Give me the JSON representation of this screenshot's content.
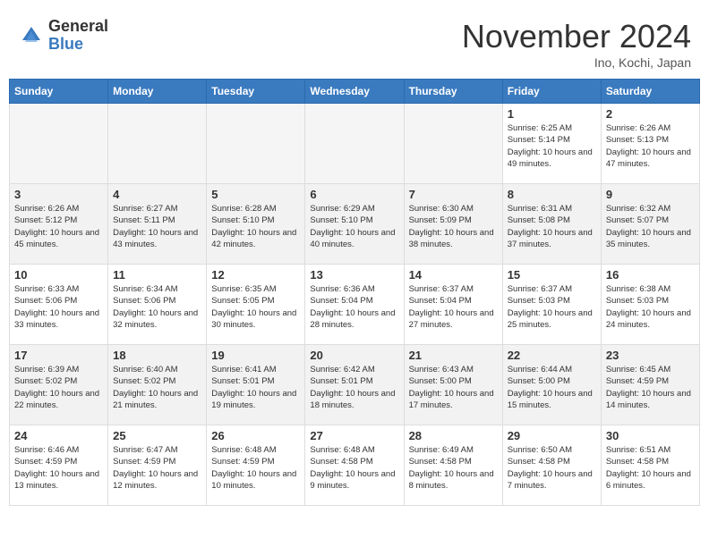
{
  "header": {
    "logo_general": "General",
    "logo_blue": "Blue",
    "month_title": "November 2024",
    "location": "Ino, Kochi, Japan"
  },
  "days_of_week": [
    "Sunday",
    "Monday",
    "Tuesday",
    "Wednesday",
    "Thursday",
    "Friday",
    "Saturday"
  ],
  "weeks": [
    [
      {
        "day": "",
        "info": ""
      },
      {
        "day": "",
        "info": ""
      },
      {
        "day": "",
        "info": ""
      },
      {
        "day": "",
        "info": ""
      },
      {
        "day": "",
        "info": ""
      },
      {
        "day": "1",
        "info": "Sunrise: 6:25 AM\nSunset: 5:14 PM\nDaylight: 10 hours and 49 minutes."
      },
      {
        "day": "2",
        "info": "Sunrise: 6:26 AM\nSunset: 5:13 PM\nDaylight: 10 hours and 47 minutes."
      }
    ],
    [
      {
        "day": "3",
        "info": "Sunrise: 6:26 AM\nSunset: 5:12 PM\nDaylight: 10 hours and 45 minutes."
      },
      {
        "day": "4",
        "info": "Sunrise: 6:27 AM\nSunset: 5:11 PM\nDaylight: 10 hours and 43 minutes."
      },
      {
        "day": "5",
        "info": "Sunrise: 6:28 AM\nSunset: 5:10 PM\nDaylight: 10 hours and 42 minutes."
      },
      {
        "day": "6",
        "info": "Sunrise: 6:29 AM\nSunset: 5:10 PM\nDaylight: 10 hours and 40 minutes."
      },
      {
        "day": "7",
        "info": "Sunrise: 6:30 AM\nSunset: 5:09 PM\nDaylight: 10 hours and 38 minutes."
      },
      {
        "day": "8",
        "info": "Sunrise: 6:31 AM\nSunset: 5:08 PM\nDaylight: 10 hours and 37 minutes."
      },
      {
        "day": "9",
        "info": "Sunrise: 6:32 AM\nSunset: 5:07 PM\nDaylight: 10 hours and 35 minutes."
      }
    ],
    [
      {
        "day": "10",
        "info": "Sunrise: 6:33 AM\nSunset: 5:06 PM\nDaylight: 10 hours and 33 minutes."
      },
      {
        "day": "11",
        "info": "Sunrise: 6:34 AM\nSunset: 5:06 PM\nDaylight: 10 hours and 32 minutes."
      },
      {
        "day": "12",
        "info": "Sunrise: 6:35 AM\nSunset: 5:05 PM\nDaylight: 10 hours and 30 minutes."
      },
      {
        "day": "13",
        "info": "Sunrise: 6:36 AM\nSunset: 5:04 PM\nDaylight: 10 hours and 28 minutes."
      },
      {
        "day": "14",
        "info": "Sunrise: 6:37 AM\nSunset: 5:04 PM\nDaylight: 10 hours and 27 minutes."
      },
      {
        "day": "15",
        "info": "Sunrise: 6:37 AM\nSunset: 5:03 PM\nDaylight: 10 hours and 25 minutes."
      },
      {
        "day": "16",
        "info": "Sunrise: 6:38 AM\nSunset: 5:03 PM\nDaylight: 10 hours and 24 minutes."
      }
    ],
    [
      {
        "day": "17",
        "info": "Sunrise: 6:39 AM\nSunset: 5:02 PM\nDaylight: 10 hours and 22 minutes."
      },
      {
        "day": "18",
        "info": "Sunrise: 6:40 AM\nSunset: 5:02 PM\nDaylight: 10 hours and 21 minutes."
      },
      {
        "day": "19",
        "info": "Sunrise: 6:41 AM\nSunset: 5:01 PM\nDaylight: 10 hours and 19 minutes."
      },
      {
        "day": "20",
        "info": "Sunrise: 6:42 AM\nSunset: 5:01 PM\nDaylight: 10 hours and 18 minutes."
      },
      {
        "day": "21",
        "info": "Sunrise: 6:43 AM\nSunset: 5:00 PM\nDaylight: 10 hours and 17 minutes."
      },
      {
        "day": "22",
        "info": "Sunrise: 6:44 AM\nSunset: 5:00 PM\nDaylight: 10 hours and 15 minutes."
      },
      {
        "day": "23",
        "info": "Sunrise: 6:45 AM\nSunset: 4:59 PM\nDaylight: 10 hours and 14 minutes."
      }
    ],
    [
      {
        "day": "24",
        "info": "Sunrise: 6:46 AM\nSunset: 4:59 PM\nDaylight: 10 hours and 13 minutes."
      },
      {
        "day": "25",
        "info": "Sunrise: 6:47 AM\nSunset: 4:59 PM\nDaylight: 10 hours and 12 minutes."
      },
      {
        "day": "26",
        "info": "Sunrise: 6:48 AM\nSunset: 4:59 PM\nDaylight: 10 hours and 10 minutes."
      },
      {
        "day": "27",
        "info": "Sunrise: 6:48 AM\nSunset: 4:58 PM\nDaylight: 10 hours and 9 minutes."
      },
      {
        "day": "28",
        "info": "Sunrise: 6:49 AM\nSunset: 4:58 PM\nDaylight: 10 hours and 8 minutes."
      },
      {
        "day": "29",
        "info": "Sunrise: 6:50 AM\nSunset: 4:58 PM\nDaylight: 10 hours and 7 minutes."
      },
      {
        "day": "30",
        "info": "Sunrise: 6:51 AM\nSunset: 4:58 PM\nDaylight: 10 hours and 6 minutes."
      }
    ]
  ]
}
